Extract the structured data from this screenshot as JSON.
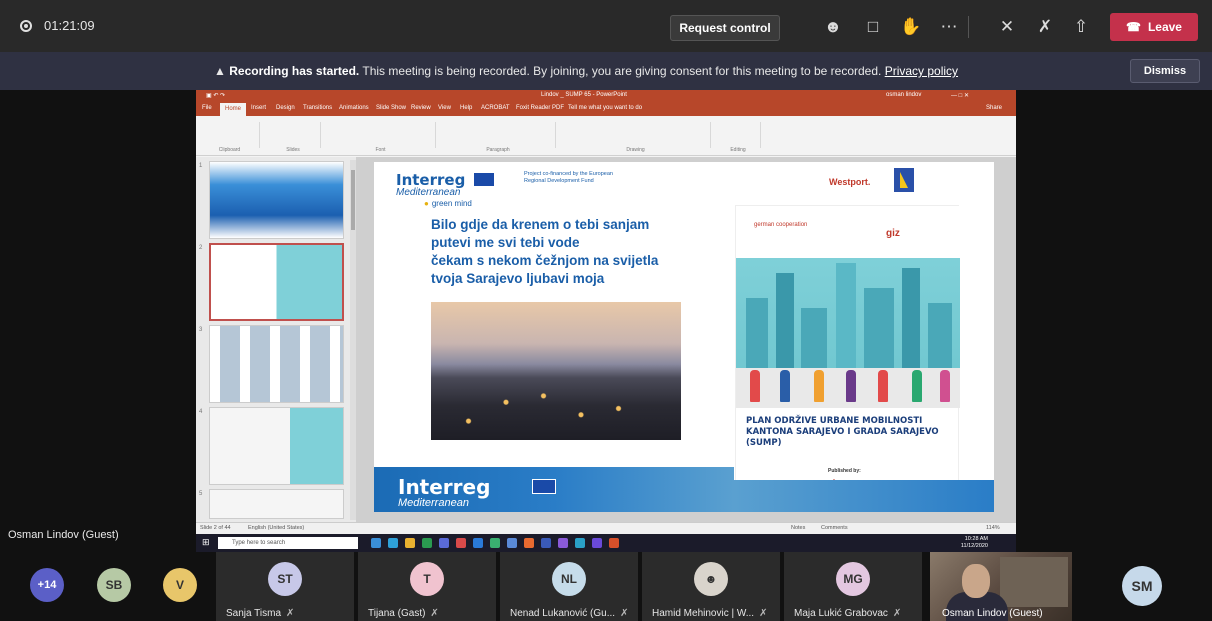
{
  "topbar": {
    "timer": "01:21:09",
    "request_control": "Request control",
    "leave": "Leave"
  },
  "banner": {
    "bold": "Recording has started.",
    "text": "This meeting is being recorded. By joining, you are giving consent for this meeting to be recorded.",
    "link": "Privacy policy",
    "dismiss": "Dismiss"
  },
  "ppt": {
    "title": "Lindov _ SUMP 65 - PowerPoint",
    "user": "osman lindov",
    "tabs": [
      "File",
      "Home",
      "Insert",
      "Design",
      "Transitions",
      "Animations",
      "Slide Show",
      "Review",
      "View",
      "Help",
      "ACROBAT",
      "Foxit Reader PDF",
      "Tell me what you want to do"
    ],
    "share": "Share",
    "groups": [
      "Clipboard",
      "Slides",
      "Font",
      "Paragraph",
      "Drawing",
      "Editing"
    ],
    "status_left": "Slide 2 of 44",
    "status_lang": "English (United States)",
    "status_notes": "Notes",
    "status_comments": "Comments",
    "zoom": "114%"
  },
  "slide": {
    "logo": "Interreg",
    "logo_sub": "Mediterranean",
    "greenmind": "green mind",
    "cofinanced": "Project co-financed by the European Regional Development Fund",
    "poem_1": "Bilo gdje da krenem o tebi sanjam",
    "poem_2": "putevi me svi tebi vode",
    "poem_3": "čekam s nekom čežnjom na svijetla",
    "poem_4": "tvoja Sarajevo ljubavi moja",
    "westport": "Westport.",
    "german": "german cooperation",
    "giz": "giz",
    "plan_title": "PLAN ODRŽIVE URBANE MOBILNOSTI KANTONA SARAJEVO I GRADA SARAJEVO (SUMP)",
    "published_by": "Published by:",
    "giz_bottom": "giz"
  },
  "taskbar": {
    "search": "Type here to search",
    "time": "10:28 AM",
    "date": "11/12/2020"
  },
  "presenter": "Osman Lindov (Guest)",
  "participants": {
    "more_count": "+14",
    "small": [
      {
        "initials": "SB",
        "color": "#b6c9a5"
      },
      {
        "initials": "V",
        "color": "#e8c66a"
      }
    ],
    "tiles": [
      {
        "initials": "ST",
        "name": "Sanja Tisma",
        "color": "#c7c8e8"
      },
      {
        "initials": "T",
        "name": "Tijana (Gast)",
        "color": "#f0c3cf"
      },
      {
        "initials": "NL",
        "name": "Nenad Lukanović (Gu...",
        "color": "#c6dcea"
      },
      {
        "initials": "",
        "name": "Hamid Mehinovic | W...",
        "color": "#d9d4cc"
      },
      {
        "initials": "MG",
        "name": "Maja Lukić Grabovac",
        "color": "#e3c7e0"
      }
    ],
    "video_name": "Osman Lindov (Guest)",
    "last_initials": "SM",
    "last_color": "#c6d9ea"
  },
  "colors": {
    "leave": "#c4314b",
    "banner": "#2f3142",
    "ppt": "#b7472a"
  }
}
